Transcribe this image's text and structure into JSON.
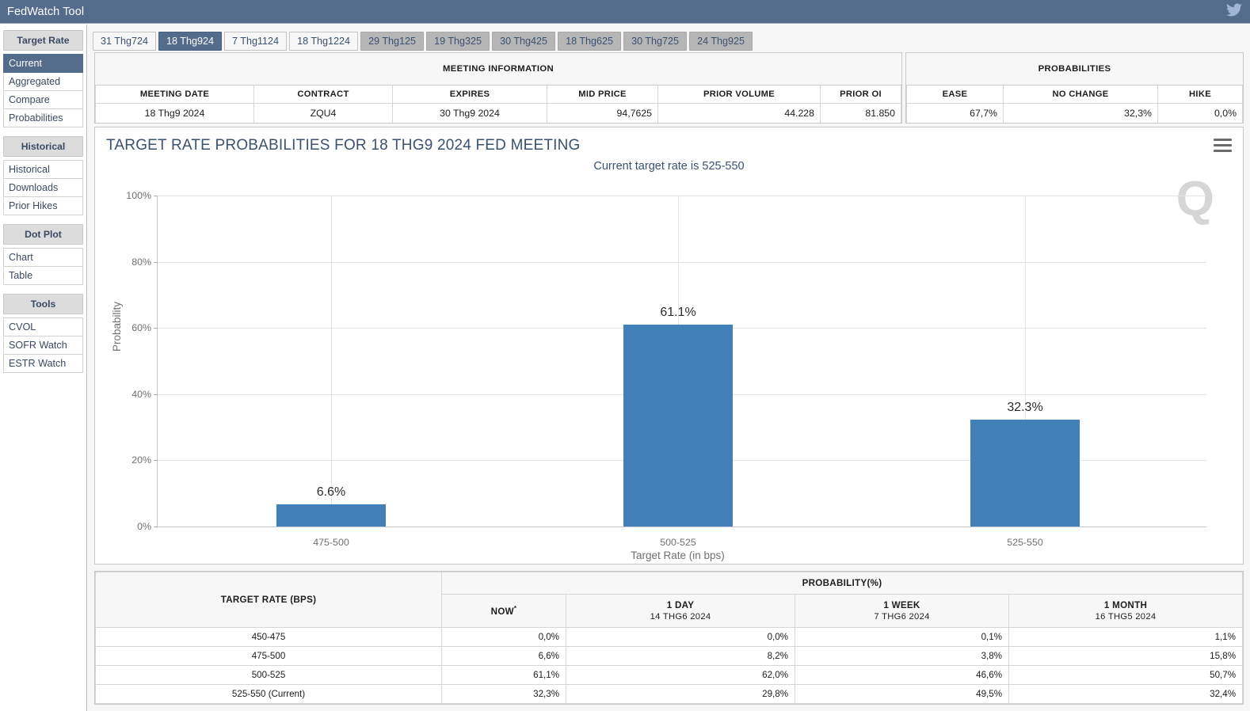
{
  "app": {
    "title": "FedWatch Tool",
    "social_icon": "twitter-icon"
  },
  "sidebar": {
    "groups": [
      {
        "heading": "Target Rate",
        "items": [
          {
            "label": "Current",
            "active": true
          },
          {
            "label": "Aggregated",
            "active": false
          },
          {
            "label": "Compare",
            "active": false
          },
          {
            "label": "Probabilities",
            "active": false
          }
        ]
      },
      {
        "heading": "Historical",
        "items": [
          {
            "label": "Historical",
            "active": false
          },
          {
            "label": "Downloads",
            "active": false
          },
          {
            "label": "Prior Hikes",
            "active": false
          }
        ]
      },
      {
        "heading": "Dot Plot",
        "items": [
          {
            "label": "Chart",
            "active": false
          },
          {
            "label": "Table",
            "active": false
          }
        ]
      },
      {
        "heading": "Tools",
        "items": [
          {
            "label": "CVOL",
            "active": false
          },
          {
            "label": "SOFR Watch",
            "active": false
          },
          {
            "label": "ESTR Watch",
            "active": false
          }
        ]
      }
    ]
  },
  "tabs": [
    {
      "label": "31 Thg724",
      "state": "normal"
    },
    {
      "label": "18 Thg924",
      "state": "active"
    },
    {
      "label": "7 Thg1124",
      "state": "normal"
    },
    {
      "label": "18 Thg1224",
      "state": "normal"
    },
    {
      "label": "29 Thg125",
      "state": "disabled"
    },
    {
      "label": "19 Thg325",
      "state": "disabled"
    },
    {
      "label": "30 Thg425",
      "state": "disabled"
    },
    {
      "label": "18 Thg625",
      "state": "disabled"
    },
    {
      "label": "30 Thg725",
      "state": "disabled"
    },
    {
      "label": "24 Thg925",
      "state": "disabled"
    }
  ],
  "meeting_information": {
    "caption": "MEETING INFORMATION",
    "headers": [
      "MEETING DATE",
      "CONTRACT",
      "EXPIRES",
      "MID PRICE",
      "PRIOR VOLUME",
      "PRIOR OI"
    ],
    "row": [
      "18 Thg9 2024",
      "ZQU4",
      "30 Thg9 2024",
      "94,7625",
      "44.228",
      "81.850"
    ]
  },
  "probabilities_summary": {
    "caption": "PROBABILITIES",
    "headers": [
      "EASE",
      "NO CHANGE",
      "HIKE"
    ],
    "row": [
      "67,7%",
      "32,3%",
      "0,0%"
    ]
  },
  "chart_data": {
    "type": "bar",
    "title": "TARGET RATE PROBABILITIES FOR 18 THG9 2024 FED MEETING",
    "subtitle": "Current target rate is 525-550",
    "categories": [
      "475-500",
      "500-525",
      "525-550"
    ],
    "values": [
      6.6,
      61.1,
      32.3
    ],
    "data_labels": [
      "6.6%",
      "61.1%",
      "32.3%"
    ],
    "xlabel": "Target Rate (in bps)",
    "ylabel": "Probability",
    "ylim": [
      0,
      100
    ],
    "ytick_labels": [
      "100%",
      "80%",
      "60%",
      "40%",
      "20%",
      "0%"
    ],
    "ytick_values": [
      100,
      80,
      60,
      40,
      20,
      0
    ],
    "grid": true,
    "legend": "none",
    "bar_color": "#4180b8",
    "menu_icon": "hamburger-menu-icon",
    "watermark": "Q"
  },
  "bottom_table": {
    "rate_header": "TARGET RATE (BPS)",
    "prob_header": "PROBABILITY(%)",
    "columns": [
      {
        "title": "NOW",
        "sup": "*",
        "sub": ""
      },
      {
        "title": "1 DAY",
        "sup": "",
        "sub": "14 THG6 2024"
      },
      {
        "title": "1 WEEK",
        "sup": "",
        "sub": "7 THG6 2024"
      },
      {
        "title": "1 MONTH",
        "sup": "",
        "sub": "16 THG5 2024"
      }
    ],
    "rows": [
      {
        "rate": "450-475",
        "now": "0,0%",
        "day": "0,0%",
        "week": "0,1%",
        "month": "1,1%"
      },
      {
        "rate": "475-500",
        "now": "6,6%",
        "day": "8,2%",
        "week": "3,8%",
        "month": "15,8%"
      },
      {
        "rate": "500-525",
        "now": "61,1%",
        "day": "62,0%",
        "week": "46,6%",
        "month": "50,7%"
      },
      {
        "rate": "525-550 (Current)",
        "now": "32,3%",
        "day": "29,8%",
        "week": "49,5%",
        "month": "32,4%"
      }
    ]
  },
  "colors": {
    "header_bar": "#546c8c",
    "accent": "#4180b8",
    "highlight": "#f7f7cf"
  }
}
